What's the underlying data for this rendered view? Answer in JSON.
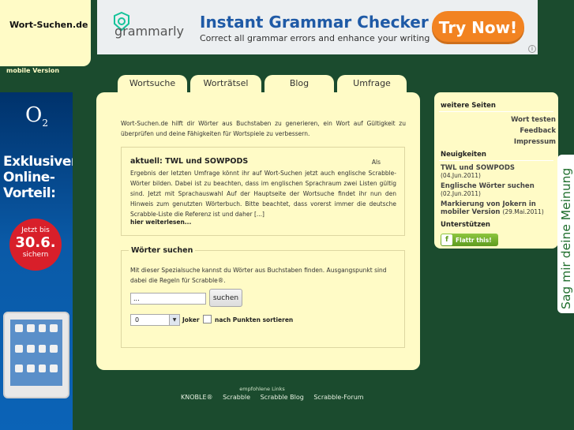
{
  "site": {
    "logo_text": "Wort-Suchen.de",
    "mobile_link": "mobile Version"
  },
  "banner_ad": {
    "brand": "grammarly",
    "headline": "Instant Grammar Checker",
    "subline": "Correct all grammar errors and enhance your writing",
    "cta": "Try Now!",
    "info_icon": "info-icon"
  },
  "side_ad": {
    "logo": "O",
    "logo_sub": "2",
    "text_lines": [
      "Exklusiver",
      "Online-",
      "Vorteil:"
    ],
    "badge_top": "Jetzt bis",
    "badge_big": "30.6.",
    "badge_bottom": "sichern"
  },
  "tabs": [
    "Wortsuche",
    "Worträtsel",
    "Blog",
    "Umfrage"
  ],
  "main": {
    "intro": "Wort-Suchen.de hilft dir Wörter aus Buchstaben zu generieren, ein Wort auf Gültigkeit zu überprüfen und deine Fähigkeiten für Wortspiele zu verbessern.",
    "news": {
      "title": "aktuell: TWL und SOWPODS",
      "als": "Als",
      "body": "Ergebnis der letzten Umfrage könnt ihr auf Wort-Suchen jetzt auch englische Scrabble-Wörter bilden. Dabei ist zu beachten, dass im englischen Sprachraum zwei Listen gültig sind. Jetzt mit Sprachauswahl Auf der Hauptseite der Wortsuche findet ihr nun den Hinweis zum genutzten Wörterbuch. Bitte beachtet, dass vorerst immer die deutsche Scrabble-Liste die Referenz ist und daher [...]",
      "more": "hier weiterlesen..."
    },
    "search": {
      "legend": "Wörter suchen",
      "description": "Mit dieser Spezialsuche kannst du Wörter aus Buchstaben finden. Ausgangspunkt sind dabei die Regeln für Scrabble®.",
      "input_value": "...",
      "button": "suchen",
      "joker_value": "0",
      "joker_label": "Joker",
      "sort_label": "nach Punkten sortieren"
    }
  },
  "sidebar": {
    "pages_heading": "weitere Seiten",
    "pages": [
      "Wort testen",
      "Feedback",
      "Impressum"
    ],
    "news_heading": "Neuigkeiten",
    "news": [
      {
        "title": "TWL und SOWPODS",
        "date": "(04.Jun.2011)"
      },
      {
        "title": "Englische Wörter suchen",
        "date": "(02.Jun.2011)"
      },
      {
        "title": "Markierung von Jokern in mobiler Version",
        "date": "(29.Mai.2011)"
      }
    ],
    "support_heading": "Unterstützen",
    "flattr_label": "Flattr this!"
  },
  "feedback_tab": "Sag mir deine Meinung",
  "footer": {
    "small": "empfohlene Links",
    "links": [
      "KNOBLE®",
      "Scrabble",
      "Scrabble Blog",
      "Scrabble-Forum"
    ]
  }
}
